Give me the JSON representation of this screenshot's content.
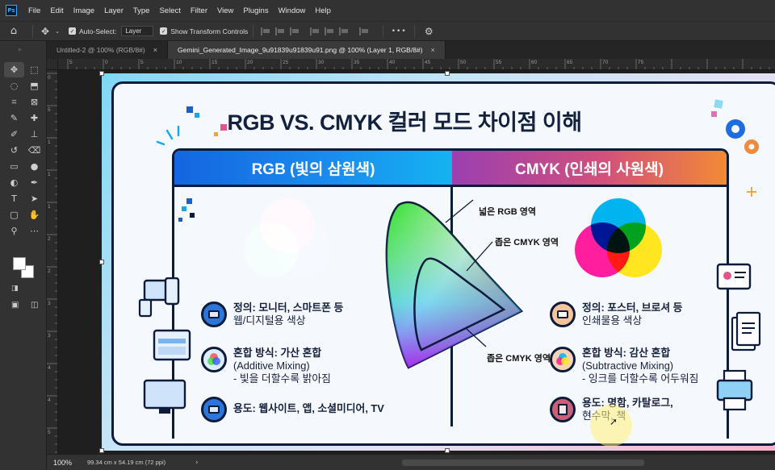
{
  "app": {
    "logo": "Ps"
  },
  "menu": [
    "File",
    "Edit",
    "Image",
    "Layer",
    "Type",
    "Select",
    "Filter",
    "View",
    "Plugins",
    "Window",
    "Help"
  ],
  "options": {
    "auto_select_label": "Auto-Select:",
    "auto_select_checked": true,
    "target_value": "Layer",
    "transform_label": "Show Transform Controls",
    "transform_checked": true,
    "more": "•••"
  },
  "tabs": [
    {
      "label": "Untitled-2 @ 100% (RGB/8#)",
      "close": "×",
      "active": false
    },
    {
      "label": "Gemini_Generated_Image_9u91839u91839u91.png @ 100% (Layer 1, RGB/8#)",
      "close": "×",
      "active": true
    }
  ],
  "rulers": {
    "h": [
      "5",
      "0",
      "5",
      "10",
      "15",
      "20",
      "25",
      "30",
      "35",
      "40",
      "45",
      "50",
      "55",
      "60",
      "65",
      "70",
      "75"
    ],
    "v": [
      "0",
      "5",
      "1",
      "1",
      "1",
      "2",
      "2",
      "3",
      "3",
      "4",
      "4",
      "5"
    ]
  },
  "document": {
    "title": "RGB VS. CMYK 컬러 모드 차이점 이해",
    "rgb_header": "RGB (빛의 삼원색)",
    "cmyk_header": "CMYK (인쇄의 사원색)",
    "rgb_items": [
      {
        "title": "정의: 모니터, 스마트폰 등",
        "line2": "웹/디지털용 색상",
        "line3": ""
      },
      {
        "title": "혼합 방식: 가산 혼합",
        "line2": "(Additive Mixing)",
        "line3": "- 빛을 더할수록 밝아짐"
      },
      {
        "title": "용도: 웹사이트, 앱, 소셜미디어, TV",
        "line2": "",
        "line3": ""
      }
    ],
    "cmyk_items": [
      {
        "title": "정의: 포스터, 브로셔 등",
        "line2": "인쇄물용 색상",
        "line3": ""
      },
      {
        "title": "혼합 방식: 감산 혼합",
        "line2": "(Subtractive Mixing)",
        "line3": "- 잉크를 더할수록 어두워짐"
      },
      {
        "title": "용도: 명함, 카탈로그,",
        "line2": "현수막, 책",
        "line3": ""
      }
    ],
    "gamut_labels": {
      "wide_rgb": "넓은 RGB 영역",
      "narrow_cmyk_top": "좁은 CMYK 영역",
      "narrow_cmyk_bottom": "좁은 CMYK 영역"
    }
  },
  "status": {
    "zoom": "100%",
    "doc_info": "99.34 cm x 54.19 cm (72 ppi)",
    "arrow": "›"
  },
  "colors": {
    "rgb_red": "#ff1e1e",
    "rgb_green": "#21e021",
    "rgb_blue": "#1a1aff",
    "cyan": "#00b4f0",
    "magenta": "#ff1e9e",
    "yellow": "#ffe61e",
    "navy": "#0d1b3a"
  }
}
